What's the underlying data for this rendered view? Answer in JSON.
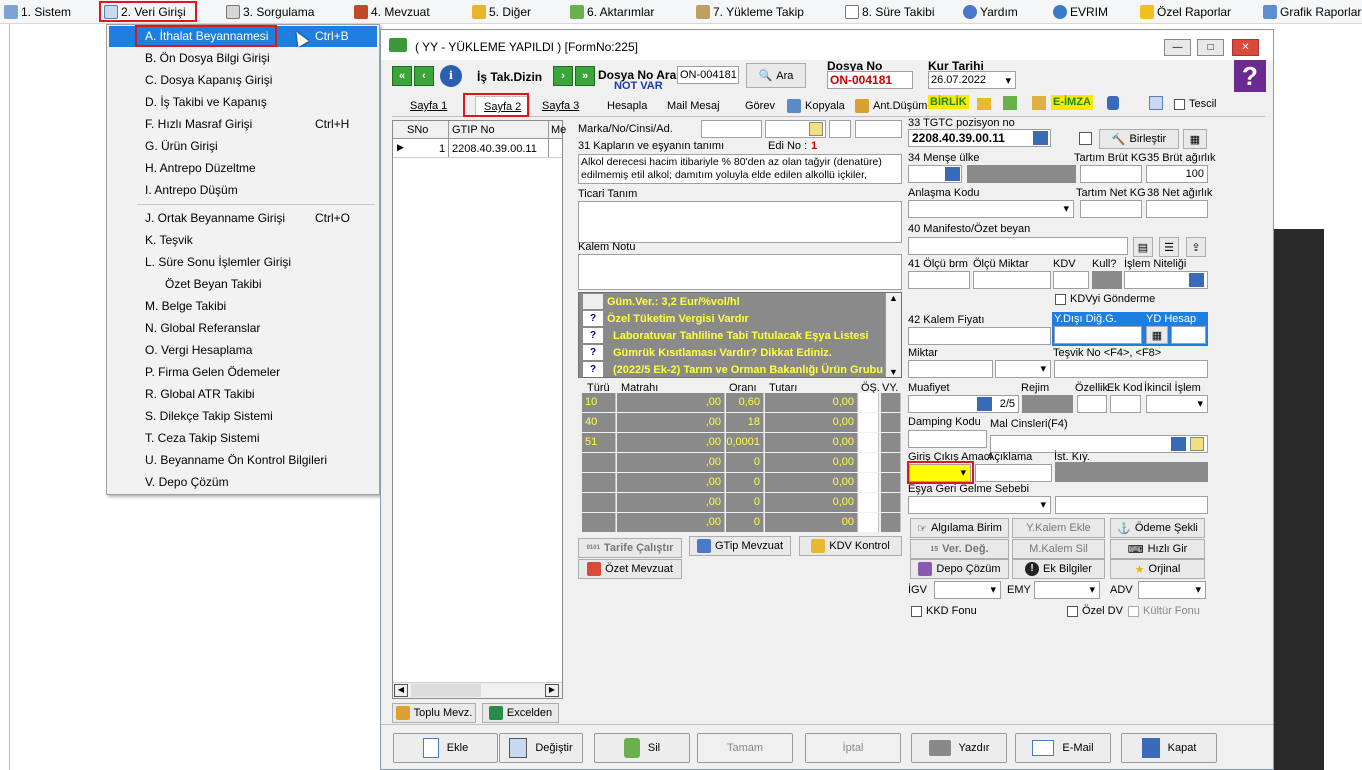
{
  "menubar": [
    "1. Sistem",
    "2. Veri Girişi",
    "3. Sorgulama",
    "4. Mevzuat",
    "5. Diğer",
    "6. Aktarımlar",
    "7. Yükleme Takip",
    "8. Süre Takibi",
    "Yardım",
    "EVRIM",
    "Özel Raporlar",
    "Grafik Raporlar"
  ],
  "dropdown": [
    {
      "label": "A. İthalat Beyannamesi",
      "key": "Ctrl+B"
    },
    {
      "label": "B. Ön Dosya Bilgi Girişi",
      "key": ""
    },
    {
      "label": "C. Dosya Kapanış Girişi",
      "key": ""
    },
    {
      "label": "D. İş Takibi ve Kapanış",
      "key": ""
    },
    {
      "label": "F. Hızlı Masraf Girişi",
      "key": "Ctrl+H"
    },
    {
      "label": "G. Ürün Girişi",
      "key": ""
    },
    {
      "label": "H. Antrepo Düzeltme",
      "key": ""
    },
    {
      "label": "I. Antrepo Düşüm",
      "key": ""
    },
    {
      "label": "J. Ortak Beyanname Girişi",
      "key": "Ctrl+O"
    },
    {
      "label": "K. Teşvik",
      "key": ""
    },
    {
      "label": "L. Süre Sonu İşlemler Girişi",
      "key": ""
    },
    {
      "label": "Özet Beyan Takibi",
      "key": ""
    },
    {
      "label": "M. Belge Takibi",
      "key": ""
    },
    {
      "label": "N. Global Referanslar",
      "key": ""
    },
    {
      "label": "O. Vergi Hesaplama",
      "key": ""
    },
    {
      "label": "P. Firma Gelen Ödemeler",
      "key": ""
    },
    {
      "label": "R. Global ATR Takibi",
      "key": ""
    },
    {
      "label": "S. Dilekçe Takip Sistemi",
      "key": ""
    },
    {
      "label": "T. Ceza Takip Sistemi",
      "key": ""
    },
    {
      "label": "U. Beyanname Ön Kontrol Bilgileri",
      "key": ""
    },
    {
      "label": "V. Depo Çözüm",
      "key": ""
    }
  ],
  "win": {
    "title": "( YY  - YÜKLEME YAPILDI ) [FormNo:225]",
    "is_tak": "İş Tak.Dizin",
    "dosya_no_ara": "Dosya No Ara",
    "dosya_no_ara_val": "ON-004181",
    "not_var": "NOT VAR",
    "ara": "Ara",
    "dosya_no": "Dosya No",
    "dosya_no_val": "ON-004181",
    "kur_tarihi": "Kur Tarihi",
    "kur_tarihi_val": "26.07.2022",
    "tabs": [
      "Sayfa 1",
      "Sayfa 2",
      "Sayfa 3",
      "Hesapla",
      "Mail Mesaj",
      "Görev",
      "Kopyala",
      "Ant.Düşüm",
      "BİRLİK",
      "E-İMZA",
      "Tescil"
    ]
  },
  "grid": {
    "h1": "SNo",
    "h2": "GTIP No",
    "h3": "Me",
    "sno": "1",
    "gtip": "2208.40.39.00.11"
  },
  "left_btns": [
    "Toplu Mevz.",
    "Excelden"
  ],
  "mid": {
    "marka": "Marka/No/Cinsi/Ad.",
    "kaplar": "31 Kapların ve eşyanın tanımı",
    "edi": "Edi No :",
    "edi_val": "1",
    "desc": "Alkol derecesi hacim itibariyle % 80'den az olan tağyir (denatüre) edilmemiş etil alkol; damıtım yoluyla elde edilen alkollü içkiler, likörler",
    "ticari": "Ticari Tanım",
    "kalem": "Kalem Notu",
    "gray_lines": [
      "Güm.Ver.: 3,2 Eur/%vol/hl",
      "Özel Tüketim Vergisi Vardır",
      "Laboratuvar Tahliline Tabi Tutulacak Eşya Listesi",
      "Gümrük Kısıtlaması Vardır? Dikkat Ediniz.",
      "(2022/5 Ek-2) Tarım ve Orman Bakanlığı Ürün Grubu"
    ],
    "th": [
      "Türü",
      "Matrahı",
      "Oranı",
      "Tutarı",
      "ÖŞ.",
      "VY."
    ],
    "rows": [
      [
        "10",
        ",00",
        "0,60",
        "0,00"
      ],
      [
        "40",
        ",00",
        "18",
        "0,00"
      ],
      [
        "51",
        ",00",
        "0,0001",
        "0,00"
      ],
      [
        "",
        ",00",
        "0",
        "0,00"
      ],
      [
        "",
        ",00",
        "0",
        "0,00"
      ],
      [
        "",
        ",00",
        "0",
        "0,00"
      ],
      [
        "",
        ",00",
        "0",
        "00"
      ]
    ],
    "btns": [
      "Tarife Çalıştır",
      "GTip Mevzuat",
      "KDV Kontrol",
      "Özet Mevzuat"
    ]
  },
  "right": {
    "tgtc": "33 TGTC pozisyon no",
    "tgtc_val": "2208.40.39.00.11",
    "birlestir": "Birleştir",
    "mense": "34 Menşe ülke",
    "tartim_brut": "Tartım Brüt KG",
    "brut": "35 Brüt ağırlık",
    "brut_val": "100",
    "anlasma": "Anlaşma Kodu",
    "tartim_net": "Tartım Net KG",
    "net": "38 Net ağırlık",
    "manifesto": "40 Manifesto/Özet beyan",
    "olcu_brm": "41 Ölçü brm",
    "olcu_mik": "Ölçü Miktar",
    "kdv": "KDV",
    "kull": "Kull?",
    "islem": "İşlem Niteliği",
    "kdvyi": "KDVyi Gönderme",
    "kalem_fiyati": "42 Kalem Fiyatı",
    "yd_dig": "Y.Dışı Diğ.G.",
    "yd_hesap": "YD Hesap",
    "miktar": "Miktar",
    "tesvik": "Teşvik No <F4>, <F8>",
    "muafiyet": "Muafiyet",
    "muaf_val": "2/5",
    "rejim": "Rejim",
    "ozellik": "Özellik",
    "ek_kod": "Ek Kod",
    "ikincil": "İkincil İşlem",
    "damping": "Damping Kodu",
    "mal_cins": "Mal Cinsleri(F4)",
    "giris": "Giriş Çıkış Amacı",
    "aciklama": "Açıklama",
    "ist_kiy": "İst. Kıy.",
    "esya_geri": "Eşya Geri Gelme Sebebi",
    "btns": [
      "Algılama Birim",
      "Y.Kalem Ekle",
      "Ödeme Şekli",
      "Ver. Değ.",
      "M.Kalem Sil",
      "Hızlı Gir",
      "Depo Çözüm",
      "Ek Bilgiler",
      "Orjinal"
    ],
    "igv": "İGV",
    "emy": "EMY",
    "adv": "ADV",
    "kkd": "KKD Fonu",
    "ozel_dv": "Özel DV",
    "kultur": "Kültür Fonu"
  },
  "bottom": [
    "Ekle",
    "Değiştir",
    "Sil",
    "Tamam",
    "İptal",
    "Yazdır",
    "E-Mail",
    "Kapat"
  ]
}
